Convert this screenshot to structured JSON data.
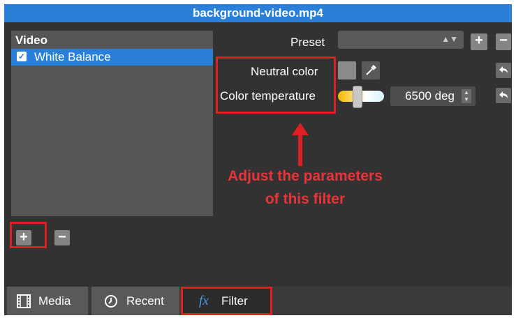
{
  "window": {
    "title": "background-video.mp4"
  },
  "filters_panel": {
    "heading": "Video",
    "items": [
      {
        "label": "White Balance",
        "checked": true,
        "check_mark": "✓"
      }
    ],
    "add_label": "+",
    "remove_label": "−"
  },
  "params": {
    "preset_label": "Preset",
    "preset_value": "",
    "preset_add": "+",
    "preset_remove": "−",
    "neutral_color_label": "Neutral color",
    "neutral_color_value": "#8a8a8a",
    "color_temperature_label": "Color temperature",
    "color_temperature_value": "6500 deg"
  },
  "annotation": {
    "line1": "Adjust the parameters",
    "line2": "of this filter"
  },
  "tabs": [
    {
      "label": "Media",
      "icon": "film-icon"
    },
    {
      "label": "Recent",
      "icon": "clock-icon"
    },
    {
      "label": "Filter",
      "icon": "fx-icon",
      "icon_text": "fx"
    }
  ],
  "colors": {
    "accent": "#2a7fd9",
    "annotation": "#e02020"
  }
}
